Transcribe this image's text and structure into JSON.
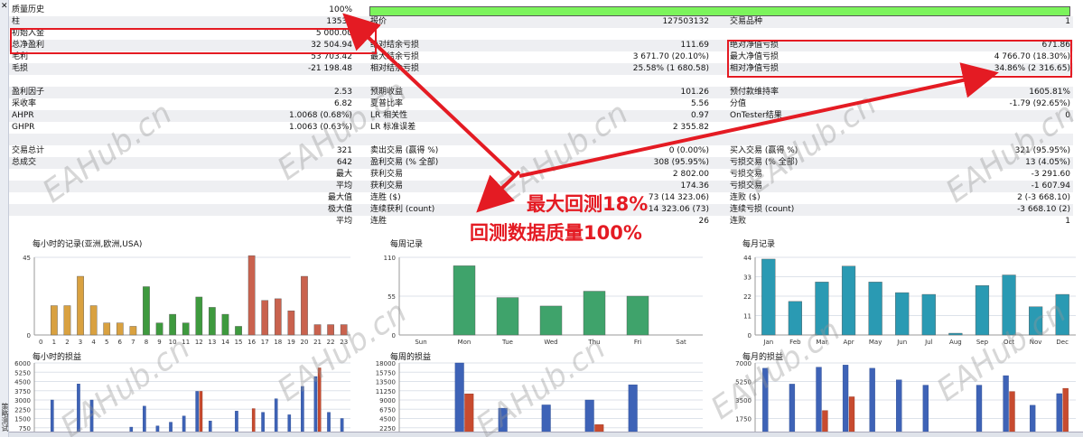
{
  "left_toolbar": {
    "close_glyph": "✕",
    "vertical_label": "策略测试"
  },
  "header": {
    "quality_label": "质量历史",
    "quality_value": "100%",
    "quality_level": 1.0,
    "quality_bar_color": "#7cf45c"
  },
  "rows": [
    {
      "c1": [
        "柱",
        "13535"
      ],
      "c2": [
        "报价",
        "127503132"
      ],
      "c3": [
        "交易品种",
        "1"
      ]
    },
    {
      "c1": [
        "初始入金",
        "5 000.00"
      ],
      "c2": [
        "",
        ""
      ],
      "c3": [
        "",
        ""
      ]
    },
    {
      "c1": [
        "总净盈利",
        "32 504.94"
      ],
      "c2": [
        "绝对结余亏损",
        "111.69"
      ],
      "c3": [
        "绝对净值亏损",
        "671.86"
      ]
    },
    {
      "c1": [
        "毛利",
        "53 703.42"
      ],
      "c2": [
        "最大结余亏损",
        "3 671.70 (20.10%)"
      ],
      "c3": [
        "最大净值亏损",
        "4 766.70 (18.30%)"
      ]
    },
    {
      "c1": [
        "毛损",
        "-21 198.48"
      ],
      "c2": [
        "相对结余亏损",
        "25.58% (1 680.58)"
      ],
      "c3": [
        "相对净值亏损",
        "34.86% (2 316.65)"
      ]
    },
    {
      "c1": [
        "",
        ""
      ],
      "c2": [
        "",
        ""
      ],
      "c3": [
        "",
        ""
      ]
    },
    {
      "c1": [
        "盈利因子",
        "2.53"
      ],
      "c2": [
        "预期收益",
        "101.26"
      ],
      "c3": [
        "预付款维持率",
        "1605.81%"
      ]
    },
    {
      "c1": [
        "采收率",
        "6.82"
      ],
      "c2": [
        "夏普比率",
        "5.56"
      ],
      "c3": [
        "分值",
        "-1.79 (92.65%)"
      ]
    },
    {
      "c1": [
        "AHPR",
        "1.0068 (0.68%)"
      ],
      "c2": [
        "LR 相关性",
        "0.97"
      ],
      "c3": [
        "OnTester结果",
        "0"
      ]
    },
    {
      "c1": [
        "GHPR",
        "1.0063 (0.63%)"
      ],
      "c2": [
        "LR 标准误差",
        "2 355.82"
      ],
      "c3": [
        "",
        ""
      ]
    },
    {
      "c1": [
        "",
        ""
      ],
      "c2": [
        "",
        ""
      ],
      "c3": [
        "",
        ""
      ]
    },
    {
      "c1": [
        "交易总计",
        "321"
      ],
      "c2": [
        "卖出交易 (赢得 %)",
        "0 (0.00%)"
      ],
      "c3": [
        "买入交易 (赢得 %)",
        "321 (95.95%)"
      ]
    },
    {
      "c1": [
        "总成交",
        "642"
      ],
      "c2": [
        "盈利交易 (% 全部)",
        "308 (95.95%)"
      ],
      "c3": [
        "亏损交易 (% 全部)",
        "13 (4.05%)"
      ]
    },
    {
      "c1": [
        "",
        "最大"
      ],
      "c2": [
        "获利交易",
        "2 802.00"
      ],
      "c3": [
        "亏损交易",
        "-3 291.60"
      ]
    },
    {
      "c1": [
        "",
        "平均"
      ],
      "c2": [
        "获利交易",
        "174.36"
      ],
      "c3": [
        "亏损交易",
        "-1 607.94"
      ]
    },
    {
      "c1": [
        "",
        "最大值"
      ],
      "c2": [
        "连胜 ($)",
        "73 (14 323.06)"
      ],
      "c3": [
        "连败 ($)",
        "2 (-3 668.10)"
      ]
    },
    {
      "c1": [
        "",
        "极大值"
      ],
      "c2": [
        "连续获利 (count)",
        "14 323.06 (73)"
      ],
      "c3": [
        "连续亏损 (count)",
        "-3 668.10 (2)"
      ]
    },
    {
      "c1": [
        "",
        "平均"
      ],
      "c2": [
        "连胜",
        "26"
      ],
      "c3": [
        "连败",
        "1"
      ]
    }
  ],
  "annotations": {
    "line1": "最大回测18%",
    "line2": "回测数据质量100%",
    "color": "#e41b23"
  },
  "watermark": "EAHub.cn",
  "charts": {
    "hourly_count": {
      "title": "每小时的记录(亚洲,欧洲,USA)",
      "yticks": [
        "45",
        "0"
      ],
      "ymax": 45,
      "categories": [
        "0",
        "1",
        "2",
        "3",
        "4",
        "5",
        "6",
        "7",
        "8",
        "9",
        "10",
        "11",
        "12",
        "13",
        "14",
        "15",
        "16",
        "17",
        "18",
        "19",
        "20",
        "21",
        "22",
        "23"
      ],
      "values": [
        0,
        17,
        17,
        34,
        17,
        7,
        7,
        5,
        28,
        7,
        12,
        7,
        22,
        16,
        12,
        5,
        46,
        20,
        21,
        14,
        34,
        6,
        6,
        6
      ],
      "colors": [
        "#d9a140",
        "#d9a140",
        "#d9a140",
        "#d9a140",
        "#d9a140",
        "#d9a140",
        "#d9a140",
        "#d9a140",
        "#3e9a3e",
        "#3e9a3e",
        "#3e9a3e",
        "#3e9a3e",
        "#3e9a3e",
        "#3e9a3e",
        "#3e9a3e",
        "#3e9a3e",
        "#c9624e",
        "#c9624e",
        "#c9624e",
        "#c9624e",
        "#c9624e",
        "#c9624e",
        "#c9624e",
        "#c9624e"
      ]
    },
    "weekly_count": {
      "title": "每周记录",
      "yticks": [
        "110",
        "55",
        "0"
      ],
      "ymax": 110,
      "categories": [
        "Sun",
        "Mon",
        "Tue",
        "Wed",
        "Thu",
        "Fri",
        "Sat"
      ],
      "values": [
        0,
        98,
        53,
        41,
        62,
        55,
        0
      ],
      "color": "#3fa36b"
    },
    "monthly_count": {
      "title": "每月记录",
      "yticks": [
        "44",
        "33",
        "22",
        "11",
        "0"
      ],
      "ymax": 44,
      "categories": [
        "Jan",
        "Feb",
        "Mar",
        "Apr",
        "May",
        "Jun",
        "Jul",
        "Aug",
        "Sep",
        "Oct",
        "Nov",
        "Dec"
      ],
      "values": [
        43,
        19,
        30,
        39,
        30,
        24,
        23,
        1,
        28,
        34,
        16,
        23
      ],
      "color": "#2a9ab3"
    },
    "hourly_pl": {
      "title": "每小时的损益",
      "yticks": [
        "6000",
        "5250",
        "4500",
        "3750",
        "3000",
        "2250",
        "1500",
        "750"
      ],
      "ymax": 6000,
      "ymin": 750,
      "profit": [
        0,
        3000,
        0,
        4300,
        3000,
        0,
        0,
        800,
        2500,
        900,
        1200,
        1700,
        3700,
        1300,
        0,
        2100,
        0,
        2000,
        3100,
        1800,
        4100,
        4900,
        2000,
        1500
      ],
      "loss": [
        0,
        0,
        0,
        0,
        0,
        0,
        0,
        0,
        0,
        0,
        0,
        0,
        3700,
        0,
        0,
        0,
        2300,
        0,
        0,
        0,
        0,
        5600,
        0,
        0
      ]
    },
    "weekly_pl": {
      "title": "每周的损益",
      "yticks": [
        "18000",
        "15750",
        "13500",
        "11250",
        "9000",
        "6750",
        "4500",
        "2250"
      ],
      "ymax": 18000,
      "ymin": 2250,
      "profit": [
        0,
        18000,
        7000,
        7800,
        9000,
        12700,
        0
      ],
      "loss": [
        0,
        10500,
        0,
        0,
        3000,
        0,
        0
      ]
    },
    "monthly_pl": {
      "title": "每月的损益",
      "yticks": [
        "7000",
        "5250",
        "3500",
        "1750"
      ],
      "ymax": 7000,
      "ymin": 0,
      "profit": [
        6500,
        5000,
        6600,
        6800,
        6500,
        5400,
        4900,
        0,
        4900,
        5800,
        3000,
        4100
      ],
      "loss": [
        0,
        0,
        2500,
        3800,
        0,
        0,
        0,
        0,
        0,
        4300,
        0,
        4600
      ]
    }
  }
}
